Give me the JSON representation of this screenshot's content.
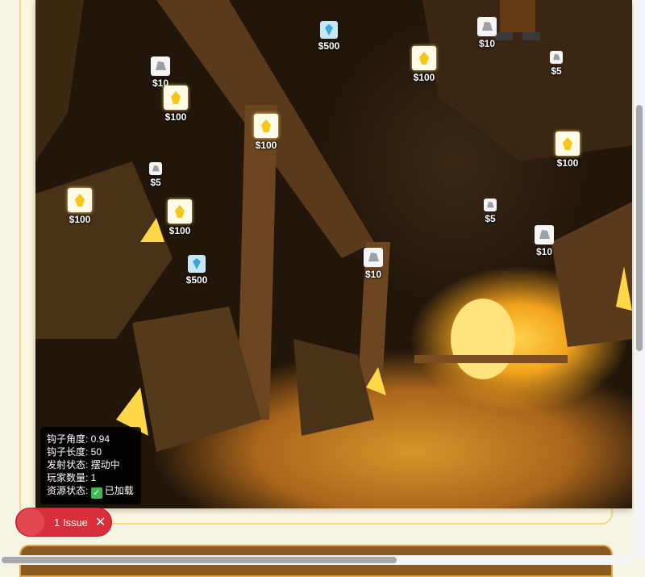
{
  "resources": [
    {
      "kind": "diamond",
      "value": "$500"
    },
    {
      "kind": "rock",
      "value": "$10"
    },
    {
      "kind": "gold",
      "value": "$100"
    },
    {
      "kind": "rock",
      "value": "$5"
    },
    {
      "kind": "rock",
      "value": "$10"
    },
    {
      "kind": "gold",
      "value": "$100"
    },
    {
      "kind": "gold",
      "value": "$100"
    },
    {
      "kind": "rock",
      "value": "$5"
    },
    {
      "kind": "gold",
      "value": "$100"
    },
    {
      "kind": "gold",
      "value": "$100"
    },
    {
      "kind": "gold",
      "value": "$100"
    },
    {
      "kind": "rock",
      "value": "$5"
    },
    {
      "kind": "rock",
      "value": "$10"
    },
    {
      "kind": "diamond",
      "value": "$500"
    },
    {
      "kind": "rock",
      "value": "$10"
    }
  ],
  "debug": {
    "hook_angle": "钩子角度: 0.94",
    "hook_length": "钩子长度: 50",
    "launch_state": "发射状态: 摆动中",
    "player_count": "玩家数量: 1",
    "asset_status_label": "资源状态:",
    "asset_status_icon": "✓",
    "asset_status_value": "已加载"
  },
  "issues": {
    "label": "1 Issue",
    "close_icon": "✕"
  },
  "colors": {
    "gold": "#f5c518",
    "diamond": "#3aa6d8",
    "rock": "#9aa0a6",
    "issue_red": "#d92f3a",
    "success_green": "#3cba54"
  }
}
